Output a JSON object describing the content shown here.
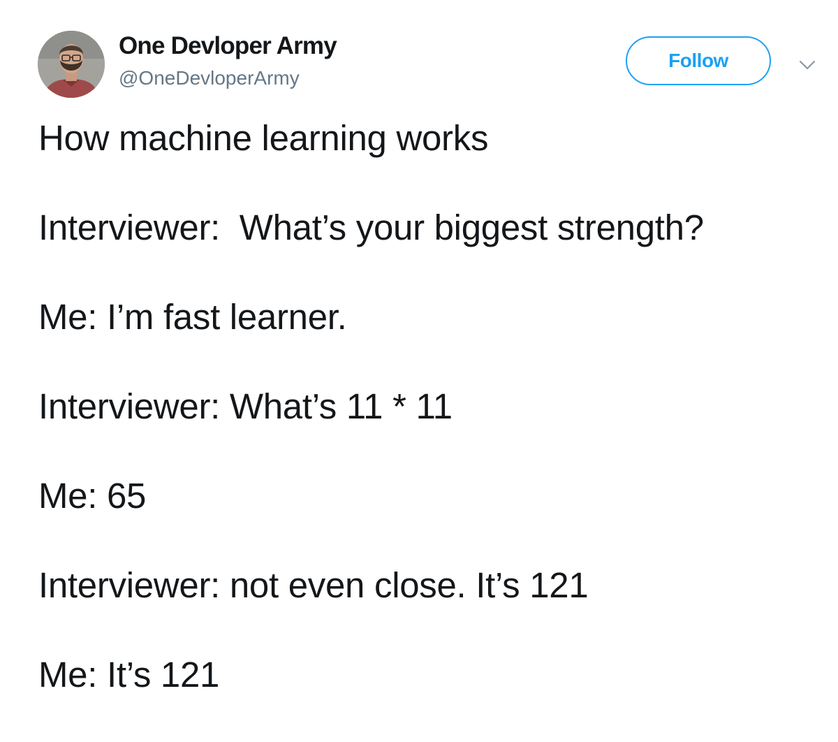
{
  "user": {
    "display_name": "One Devloper Army",
    "handle": "@OneDevloperArmy"
  },
  "actions": {
    "follow_label": "Follow",
    "menu_icon": "chevron-down-icon"
  },
  "tweet": {
    "lines": [
      "How machine learning works",
      "Interviewer:  What’s your biggest strength?",
      "Me: I’m fast learner.",
      "Interviewer: What’s 11 * 11",
      "Me: 65",
      "Interviewer: not even close. It’s 121",
      "Me: It’s 121"
    ]
  },
  "colors": {
    "text": "#14171a",
    "muted": "#657786",
    "accent": "#1da1f2",
    "background": "#ffffff"
  }
}
